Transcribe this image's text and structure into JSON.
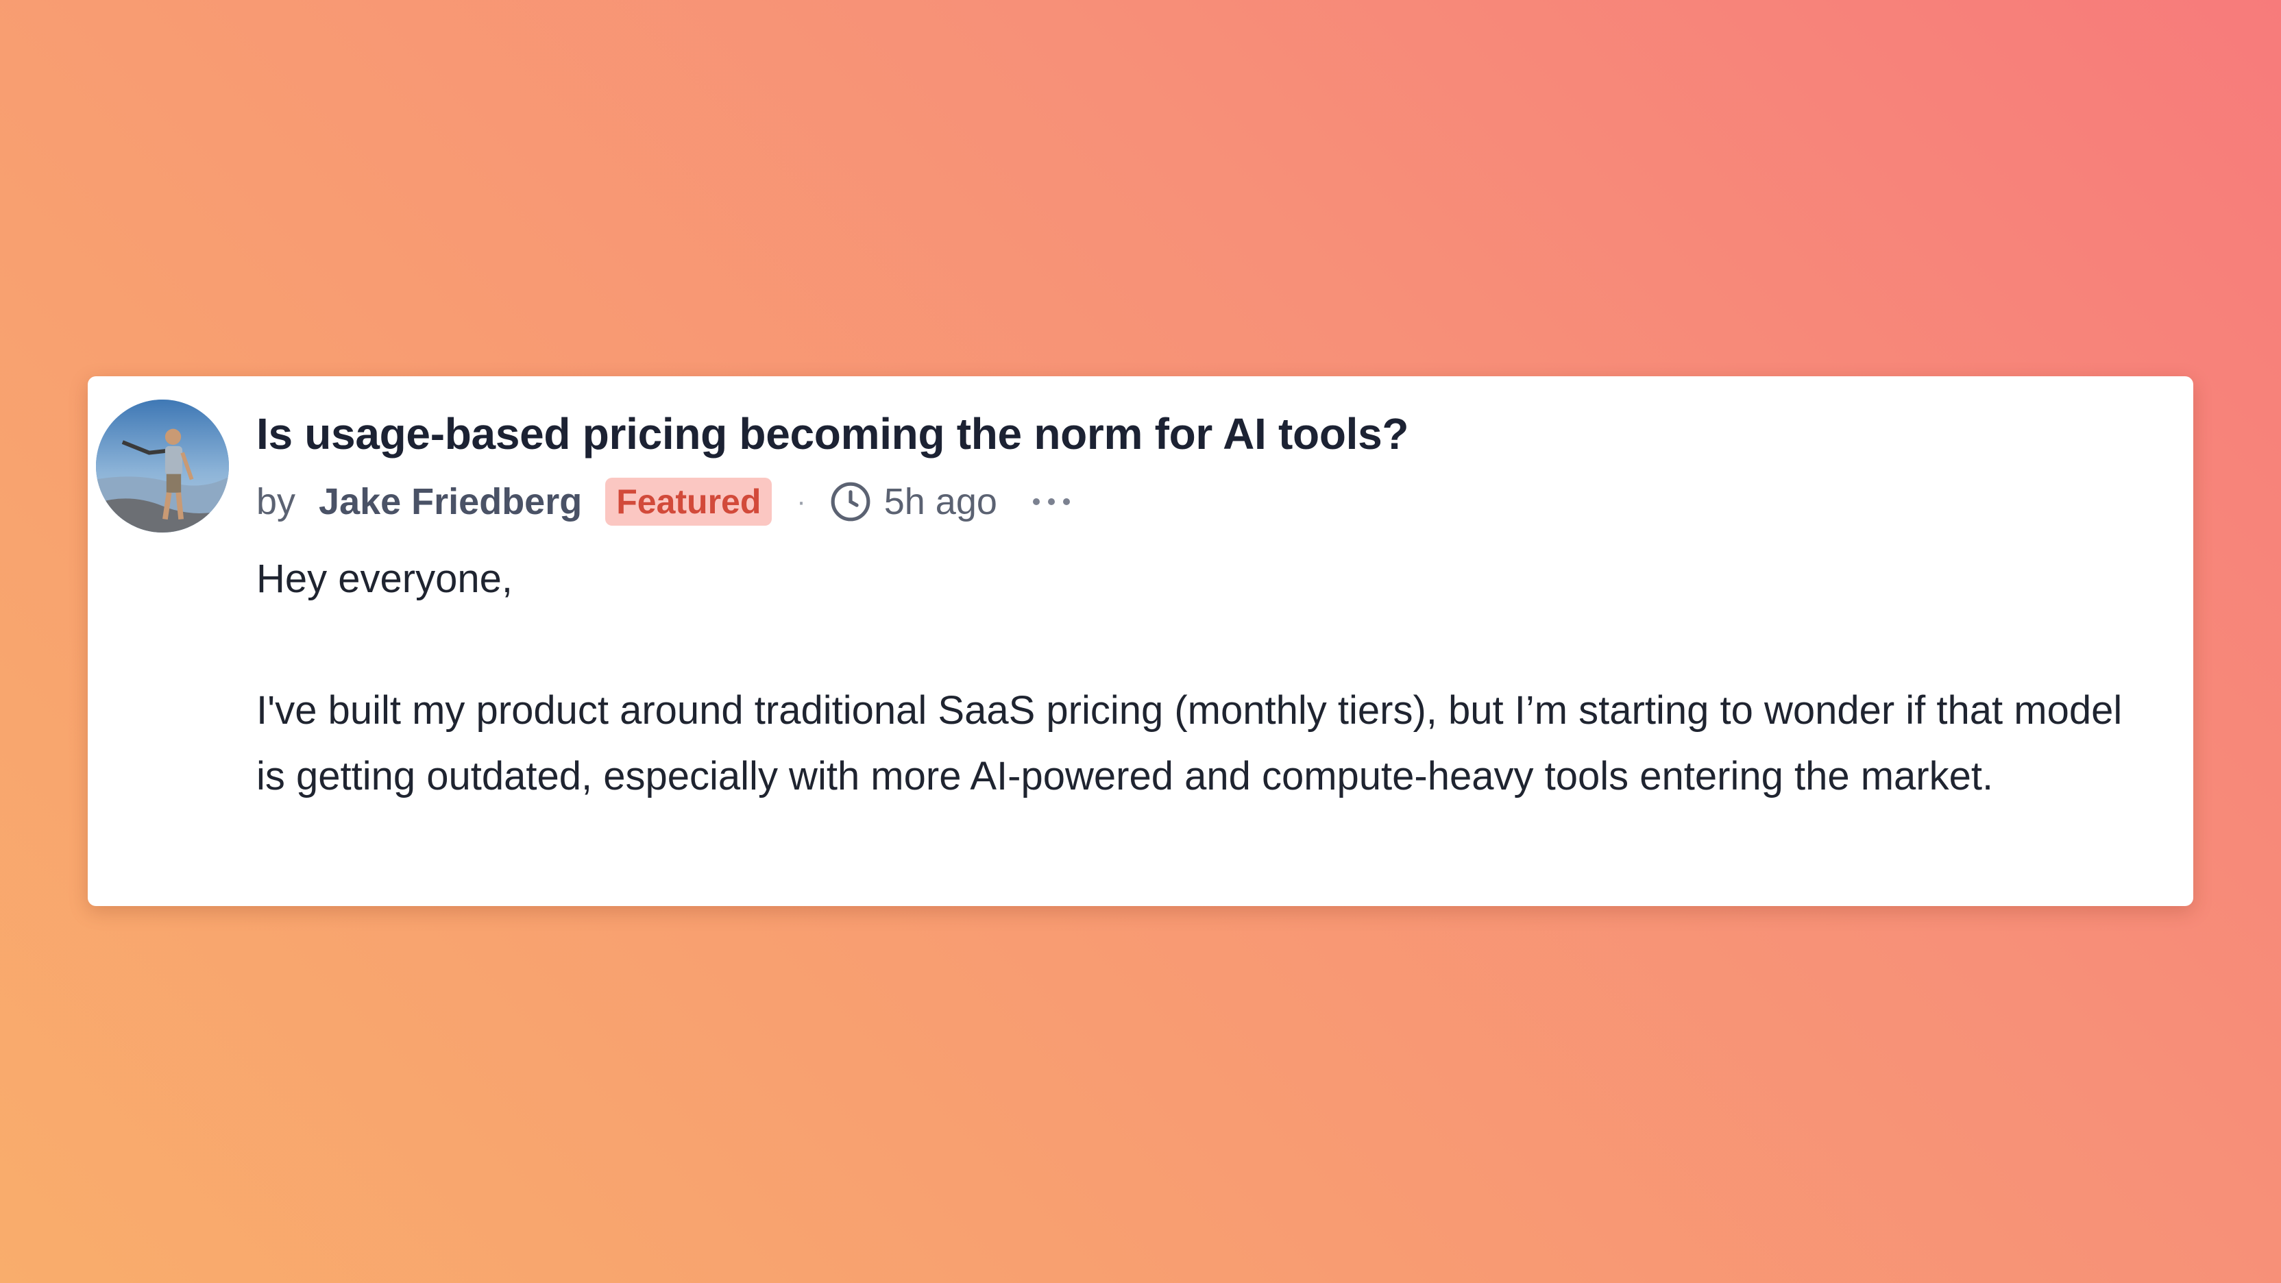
{
  "post": {
    "title": "Is usage-based pricing becoming the norm for AI tools?",
    "by_label": "by",
    "author": "Jake Friedberg",
    "badge": "Featured",
    "separator": "·",
    "time": "5h ago",
    "greeting": "Hey everyone,",
    "body": "I've built my product around traditional SaaS pricing (monthly tiers), but I’m starting to wonder if that model is getting outdated, especially with more AI-powered and compute-heavy tools en­tering the market."
  },
  "icons": {
    "avatar": "avatar-photo",
    "clock": "clock-icon",
    "more": "more-options-icon"
  },
  "colors": {
    "badge_bg": "#fbc7c2",
    "badge_text": "#d24a3a",
    "title": "#1c2233",
    "card": "#ffffff"
  }
}
